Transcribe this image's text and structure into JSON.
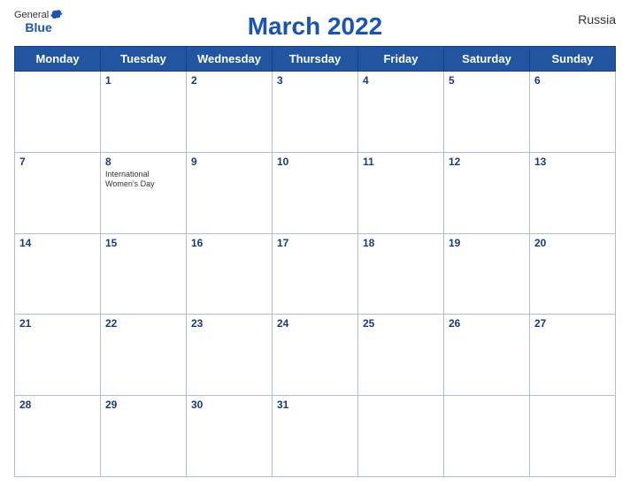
{
  "header": {
    "logo_general": "General",
    "logo_blue": "Blue",
    "title": "March 2022",
    "country": "Russia"
  },
  "weekdays": [
    "Monday",
    "Tuesday",
    "Wednesday",
    "Thursday",
    "Friday",
    "Saturday",
    "Sunday"
  ],
  "weeks": [
    [
      {
        "day": "",
        "events": []
      },
      {
        "day": "1",
        "events": []
      },
      {
        "day": "2",
        "events": []
      },
      {
        "day": "3",
        "events": []
      },
      {
        "day": "4",
        "events": []
      },
      {
        "day": "5",
        "events": []
      },
      {
        "day": "6",
        "events": []
      }
    ],
    [
      {
        "day": "7",
        "events": []
      },
      {
        "day": "8",
        "events": [
          "International Women's Day"
        ]
      },
      {
        "day": "9",
        "events": []
      },
      {
        "day": "10",
        "events": []
      },
      {
        "day": "11",
        "events": []
      },
      {
        "day": "12",
        "events": []
      },
      {
        "day": "13",
        "events": []
      }
    ],
    [
      {
        "day": "14",
        "events": []
      },
      {
        "day": "15",
        "events": []
      },
      {
        "day": "16",
        "events": []
      },
      {
        "day": "17",
        "events": []
      },
      {
        "day": "18",
        "events": []
      },
      {
        "day": "19",
        "events": []
      },
      {
        "day": "20",
        "events": []
      }
    ],
    [
      {
        "day": "21",
        "events": []
      },
      {
        "day": "22",
        "events": []
      },
      {
        "day": "23",
        "events": []
      },
      {
        "day": "24",
        "events": []
      },
      {
        "day": "25",
        "events": []
      },
      {
        "day": "26",
        "events": []
      },
      {
        "day": "27",
        "events": []
      }
    ],
    [
      {
        "day": "28",
        "events": []
      },
      {
        "day": "29",
        "events": []
      },
      {
        "day": "30",
        "events": []
      },
      {
        "day": "31",
        "events": []
      },
      {
        "day": "",
        "events": []
      },
      {
        "day": "",
        "events": []
      },
      {
        "day": "",
        "events": []
      }
    ]
  ],
  "colors": {
    "header_bg": "#2155a0",
    "header_text": "#ffffff",
    "alt_row_bg": "#dce8f8",
    "day_num_color": "#1a3a80",
    "border": "#b0bcd0",
    "title_color": "#1a56b0"
  }
}
